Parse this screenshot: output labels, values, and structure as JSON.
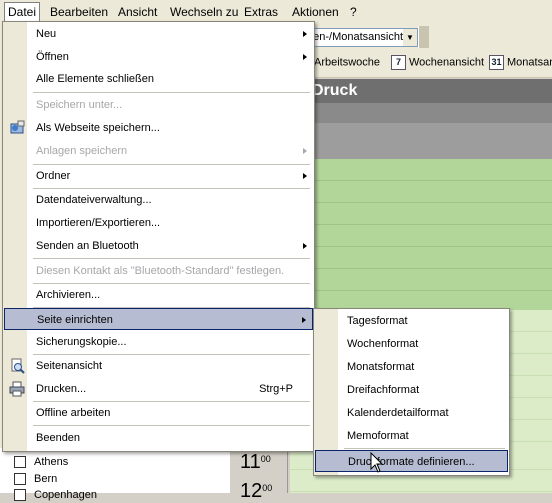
{
  "menubar": {
    "items": [
      {
        "label": "Datei",
        "active": true
      },
      {
        "label": "Bearbeiten"
      },
      {
        "label": "Ansicht"
      },
      {
        "label": "Wechseln zu"
      },
      {
        "label": "Extras"
      },
      {
        "label": "Aktionen"
      },
      {
        "label": "?"
      }
    ]
  },
  "toolbar": {
    "view_combo": "nen-/Monatsansicht",
    "buttons": [
      {
        "label": "Arbeitswoche",
        "icon": "calendar-workweek-icon"
      },
      {
        "label": "Wochenansicht",
        "icon": "calendar-week-icon",
        "badge": "7"
      },
      {
        "label": "Monatsan",
        "icon": "calendar-month-icon",
        "badge": "31"
      }
    ]
  },
  "calendar": {
    "title": "Druck",
    "hours": [
      "11",
      "12"
    ],
    "hour_suffix": "00",
    "list": [
      {
        "label": "Athens"
      },
      {
        "label": "Bern"
      },
      {
        "label": "Copenhagen"
      }
    ]
  },
  "file_menu": {
    "items": [
      {
        "label": "Neu",
        "submenu": true
      },
      {
        "label": "Öffnen",
        "submenu": true
      },
      {
        "label": "Alle Elemente schließen"
      },
      {
        "label": "Speichern unter...",
        "disabled": true
      },
      {
        "label": "Als Webseite speichern...",
        "icon": "web-page-save-icon"
      },
      {
        "label": "Anlagen speichern",
        "disabled": true,
        "submenu": true
      },
      {
        "label": "Ordner",
        "submenu": true
      },
      {
        "label": "Datendateiverwaltung..."
      },
      {
        "label": "Importieren/Exportieren..."
      },
      {
        "label": "Senden an Bluetooth",
        "submenu": true
      },
      {
        "label": "Diesen Kontakt als \"Bluetooth-Standard\" festlegen.",
        "disabled": true
      },
      {
        "label": "Archivieren..."
      },
      {
        "label": "Seite einrichten",
        "submenu": true,
        "highlighted": true
      },
      {
        "label": "Sicherungskopie..."
      },
      {
        "label": "Seitenansicht",
        "icon": "print-preview-icon"
      },
      {
        "label": "Drucken...",
        "shortcut": "Strg+P",
        "icon": "printer-icon"
      },
      {
        "label": "Offline arbeiten"
      },
      {
        "label": "Beenden"
      }
    ]
  },
  "page_setup_submenu": {
    "items": [
      {
        "label": "Tagesformat"
      },
      {
        "label": "Wochenformat"
      },
      {
        "label": "Monatsformat"
      },
      {
        "label": "Dreifachformat"
      },
      {
        "label": "Kalenderdetailformat"
      },
      {
        "label": "Memoformat"
      },
      {
        "label": "Druckformate definieren...",
        "highlighted": true
      }
    ]
  },
  "colors": {
    "menu_highlight": "#b6bdd2",
    "menu_highlight_border": "#0a246a",
    "calendar_green": "#b2d69a",
    "calendar_header": "#6f6f6f"
  }
}
